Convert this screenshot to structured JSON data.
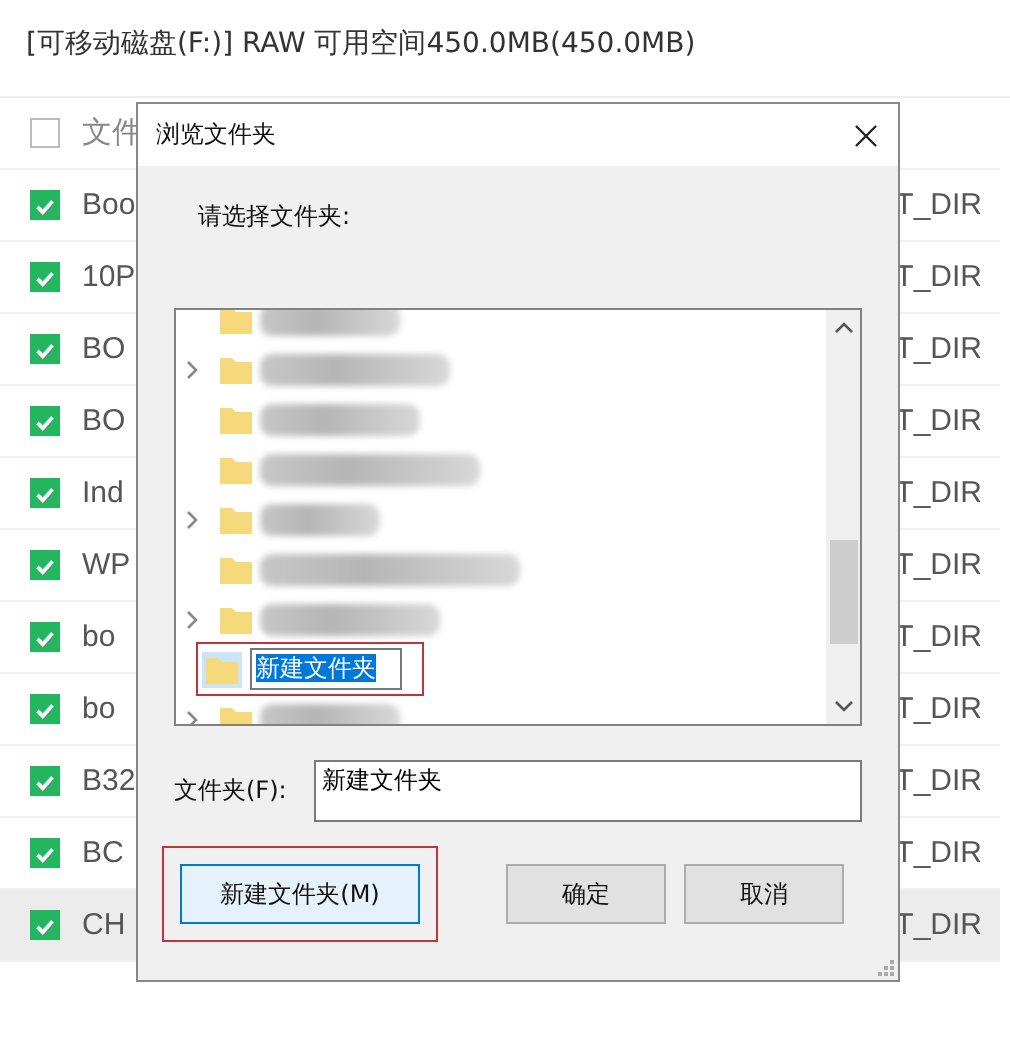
{
  "drive_info": "[可移动磁盘(F:)] RAW 可用空间450.0MB(450.0MB)",
  "list": {
    "header": {
      "label": "文件",
      "checked": false
    },
    "rows": [
      {
        "name": "Boo",
        "type": "T_DIR",
        "checked": true,
        "selected": false
      },
      {
        "name": "10P",
        "type": "T_DIR",
        "checked": true,
        "selected": false
      },
      {
        "name": "BO",
        "type": "T_DIR",
        "checked": true,
        "selected": false
      },
      {
        "name": "BO",
        "type": "T_DIR",
        "checked": true,
        "selected": false
      },
      {
        "name": "Ind",
        "type": "T_DIR",
        "checked": true,
        "selected": false
      },
      {
        "name": "WP",
        "type": "T_DIR",
        "checked": true,
        "selected": false
      },
      {
        "name": "bo",
        "type": "T_DIR",
        "checked": true,
        "selected": false
      },
      {
        "name": "bo",
        "type": "T_DIR",
        "checked": true,
        "selected": false
      },
      {
        "name": "B32",
        "type": "T_DIR",
        "checked": true,
        "selected": false
      },
      {
        "name": "BC",
        "type": "T_DIR",
        "checked": true,
        "selected": false
      },
      {
        "name": "CH",
        "type": "T_DIR",
        "checked": true,
        "selected": true
      }
    ]
  },
  "dialog": {
    "title": "浏览文件夹",
    "prompt": "请选择文件夹:",
    "tree": [
      {
        "kind": "redacted",
        "expandable": false
      },
      {
        "kind": "redacted",
        "expandable": true
      },
      {
        "kind": "redacted",
        "expandable": false
      },
      {
        "kind": "redacted",
        "expandable": false
      },
      {
        "kind": "redacted",
        "expandable": true
      },
      {
        "kind": "redacted",
        "expandable": false
      },
      {
        "kind": "redacted",
        "expandable": true
      },
      {
        "kind": "editing",
        "label": "新建文件夹",
        "expandable": false
      },
      {
        "kind": "redacted",
        "expandable": true
      }
    ],
    "folder_label": "文件夹(F):",
    "folder_value": "新建文件夹",
    "buttons": [
      {
        "label": "新建文件夹(M)",
        "highlighted": true
      },
      {
        "label": "确定",
        "highlighted": false
      },
      {
        "label": "取消",
        "highlighted": false
      }
    ]
  }
}
